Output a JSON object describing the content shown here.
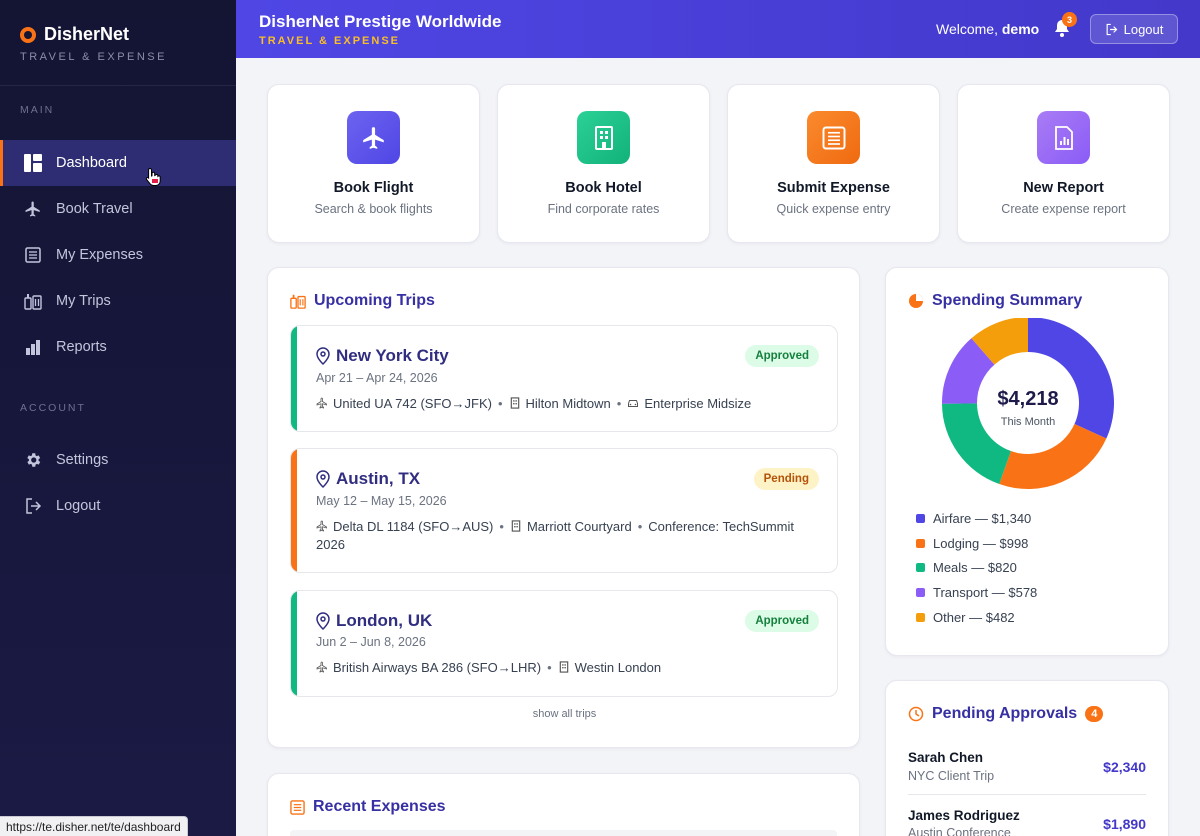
{
  "sidebar": {
    "brand": "DisherNet",
    "brand_sub": "TRAVEL & EXPENSE",
    "section_main": "MAIN",
    "section_account": "ACCOUNT",
    "items": [
      {
        "label": "Dashboard",
        "icon": "dashboard-icon",
        "active": true
      },
      {
        "label": "Book Travel",
        "icon": "airplane-icon"
      },
      {
        "label": "My Expenses",
        "icon": "receipt-icon"
      },
      {
        "label": "My Trips",
        "icon": "luggage-icon"
      },
      {
        "label": "Reports",
        "icon": "bar-chart-icon"
      },
      {
        "label": "Settings",
        "icon": "gear-icon"
      },
      {
        "label": "Logout",
        "icon": "logout-icon"
      }
    ]
  },
  "header": {
    "title": "DisherNet Prestige Worldwide",
    "subtitle": "TRAVEL & EXPENSE",
    "welcome_prefix": "Welcome,",
    "username": "demo",
    "notification_count": "3",
    "logout_label": "Logout"
  },
  "quick_actions": [
    {
      "title": "Book Flight",
      "desc": "Search & book flights",
      "color": "#5b52e6",
      "icon": "airplane-icon"
    },
    {
      "title": "Book Hotel",
      "desc": "Find corporate rates",
      "color": "#1fbf83",
      "icon": "building-icon"
    },
    {
      "title": "Submit Expense",
      "desc": "Quick expense entry",
      "color": "#f97316",
      "icon": "receipt-icon"
    },
    {
      "title": "New Report",
      "desc": "Create expense report",
      "color": "#9b6cf0",
      "icon": "report-icon"
    }
  ],
  "upcoming_trips": {
    "title": "Upcoming Trips",
    "show_all": "show all trips",
    "trips": [
      {
        "city": "New York City",
        "dates": "Apr 21 – Apr 24, 2026",
        "status": "Approved",
        "flight": "United UA 742 (SFO→JFK)",
        "hotel": "Hilton Midtown",
        "extra": "Enterprise Midsize"
      },
      {
        "city": "Austin, TX",
        "dates": "May 12 – May 15, 2026",
        "status": "Pending",
        "flight": "Delta DL 1184 (SFO→AUS)",
        "hotel": "Marriott Courtyard",
        "extra": "Conference: TechSummit 2026"
      },
      {
        "city": "London, UK",
        "dates": "Jun 2 – Jun 8, 2026",
        "status": "Approved",
        "flight": "British Airways BA 286 (SFO→LHR)",
        "hotel": "Westin London"
      }
    ]
  },
  "recent_expenses": {
    "title": "Recent Expenses"
  },
  "spending_summary": {
    "title": "Spending Summary",
    "total": "$4,218",
    "period": "This Month",
    "legend": [
      {
        "label": "Airfare — $1,340",
        "color": "#4f46e5"
      },
      {
        "label": "Lodging — $998",
        "color": "#f97316"
      },
      {
        "label": "Meals — $820",
        "color": "#10b981"
      },
      {
        "label": "Transport — $578",
        "color": "#8b5cf6"
      },
      {
        "label": "Other — $482",
        "color": "#f59e0b"
      }
    ]
  },
  "chart_data": {
    "type": "pie",
    "categories": [
      "Airfare",
      "Lodging",
      "Meals",
      "Transport",
      "Other"
    ],
    "values": [
      1340,
      998,
      820,
      578,
      482
    ],
    "colors": [
      "#4f46e5",
      "#f97316",
      "#10b981",
      "#8b5cf6",
      "#f59e0b"
    ]
  },
  "pending_approvals": {
    "title": "Pending Approvals",
    "count": "4",
    "items": [
      {
        "name": "Sarah Chen",
        "trip": "NYC Client Trip",
        "amount": "$2,340"
      },
      {
        "name": "James Rodriguez",
        "trip": "Austin Conference",
        "amount": "$1,890"
      }
    ]
  },
  "status_bar": {
    "url": "https://te.disher.net/te/dashboard"
  }
}
